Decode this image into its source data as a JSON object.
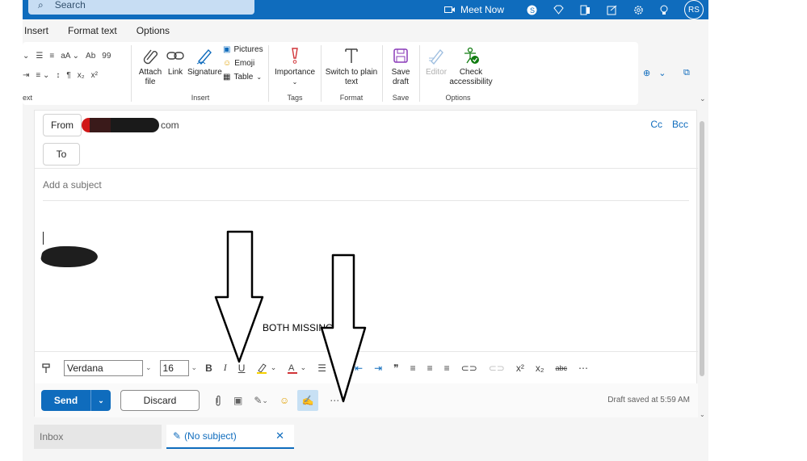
{
  "topbar": {
    "search_placeholder": "Search",
    "meet_now": "Meet Now",
    "avatar_initials": "RS"
  },
  "menu_tabs": [
    "Insert",
    "Format text",
    "Options"
  ],
  "ribbon": {
    "group_text_label": "ext",
    "insert": {
      "attach_file": "Attach file",
      "link": "Link",
      "signature": "Signature",
      "pictures": "Pictures",
      "emoji": "Emoji",
      "table": "Table",
      "group_label": "Insert"
    },
    "tags": {
      "importance": "Importance",
      "group_label": "Tags"
    },
    "format": {
      "switch_plain": "Switch to plain text",
      "group_label": "Format"
    },
    "save": {
      "save_draft": "Save draft",
      "group_label": "Save"
    },
    "options": {
      "editor": "Editor",
      "check_accessibility": "Check accessibility",
      "group_label": "Options"
    }
  },
  "compose": {
    "from_label": "From",
    "from_suffix": "com",
    "to_label": "To",
    "cc": "Cc",
    "bcc": "Bcc",
    "subject_placeholder": "Add a subject",
    "annotation": "BOTH MISSING"
  },
  "format_toolbar": {
    "font": "Verdana",
    "size": "16"
  },
  "send_row": {
    "send": "Send",
    "discard": "Discard",
    "draft_status": "Draft saved at 5:59 AM"
  },
  "bottom_tabs": {
    "inbox": "Inbox",
    "draft_tab": "(No subject)"
  },
  "colors": {
    "accent": "#0f6cbd",
    "highlight": "#f5d000",
    "font_color": "#d13438",
    "importance": "#d13438",
    "save_icon": "#8a3ab9",
    "accessibility": "#107c10"
  }
}
